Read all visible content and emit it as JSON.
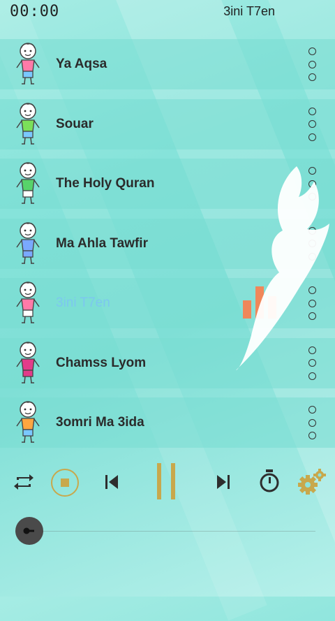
{
  "status": {
    "time": "00:00",
    "now_playing": "3ini T7en"
  },
  "tracks": [
    {
      "title": "Ya Aqsa",
      "shirt": "#ff7aa8",
      "pants": "#7ac8ff",
      "active": false
    },
    {
      "title": "Souar",
      "shirt": "#7be05a",
      "pants": "#7ac8ff",
      "active": false
    },
    {
      "title": "The Holy Quran",
      "shirt": "#57d36a",
      "pants": "#ffffff",
      "active": false
    },
    {
      "title": "Ma Ahla Tawfir",
      "shirt": "#7aa9ff",
      "pants": "#7aa9ff",
      "active": false
    },
    {
      "title": "3ini T7en",
      "shirt": "#ff7aa8",
      "pants": "#ffffff",
      "active": true
    },
    {
      "title": "Chamss Lyom",
      "shirt": "#e23c8a",
      "pants": "#e23c8a",
      "active": false
    },
    {
      "title": "3omri Ma 3ida",
      "shirt": "#ffa640",
      "pants": "#7ac8ff",
      "active": false
    }
  ],
  "controls": [
    "repeat-icon",
    "stop-icon",
    "previous-icon",
    "pause-icon",
    "next-icon",
    "timer-icon",
    "settings-icon"
  ],
  "colors": {
    "accent": "#c8a84c",
    "equalizer": "#f0875a",
    "active_title": "#7cc7ef"
  },
  "playback": {
    "progress": 0.0
  }
}
